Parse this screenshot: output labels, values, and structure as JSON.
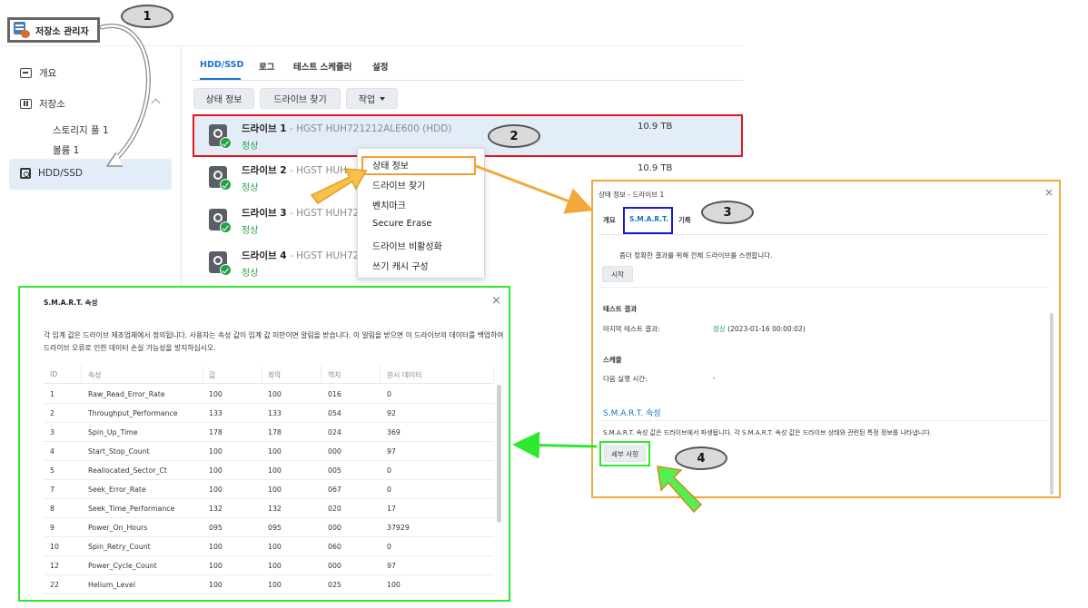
{
  "app": {
    "title": "저장소 관리자"
  },
  "sidebar": {
    "overview": "개요",
    "storage": "저장소",
    "storage_pool": "스토리지 풀 1",
    "volume": "볼륨 1",
    "hdd_ssd": "HDD/SSD"
  },
  "tabs": [
    "HDD/SSD",
    "로그",
    "테스트 스케줄러",
    "설정"
  ],
  "toolbar": {
    "status_info": "상태 정보",
    "find_drive": "드라이브 찾기",
    "action": "작업"
  },
  "drives": [
    {
      "name": "드라이브 1",
      "model": " - HGST HUH721212ALE600 (HDD)",
      "status": "정상",
      "size": "10.9 TB"
    },
    {
      "name": "드라이브 2",
      "model": " - HGST HUH",
      "status": "정상",
      "size": "10.9 TB"
    },
    {
      "name": "드라이브 3",
      "model": " - HGST HUH72",
      "status": "정상",
      "size": ""
    },
    {
      "name": "드라이브 4",
      "model": " - HGST HUH72",
      "status": "정상",
      "size": ""
    }
  ],
  "context_menu": [
    "상태 정보",
    "드라이브 찾기",
    "벤치마크",
    "Secure Erase",
    "드라이브 비활성화",
    "쓰기 캐시 구성"
  ],
  "callouts": [
    "1",
    "2",
    "3",
    "4"
  ],
  "status_dialog": {
    "title": "상태 정보 - 드라이브 1",
    "close": "×",
    "tabs": [
      "개요",
      "S.M.A.R.T.",
      "기록"
    ],
    "scan_text": "좀더 정확한 결과를 위해 전체 드라이브를 스캔합니다.",
    "start_button": "시작",
    "test_result_heading": "테스트 결과",
    "last_test_label": "마지막 테스트 결과:",
    "last_test_status": "정상",
    "last_test_time": " (2023-01-16 00:00:02)",
    "schedule_heading": "스케줄",
    "next_run_label": "다음 실행 시간:",
    "next_run_value": "-",
    "smart_attr_heading": "S.M.A.R.T. 속성",
    "smart_attr_text": "S.M.A.R.T. 속성 값은 드라이브에서 파생됩니다. 각 S.M.A.R.T. 속성 값은 드라이브 상태와 관련된 특정 정보를 나타냅니다.",
    "details_button": "세부 사항"
  },
  "smart_dialog": {
    "title": "S.M.A.R.T. 속성",
    "close": "×",
    "description": "각 임계 값은 드라이브 제조업체에서 정의됩니다. 사용자는 속성 값이 임계 값 미만이면 알림을 받습니다. 이 알림을 받으면 이 드라이브의 데이터를 백업하여 드라이브 오류로 인한 데이터 손실 가능성을 방지하십시오.",
    "columns": [
      "ID",
      "속성",
      "값",
      "최악",
      "역치",
      "원시 데이터"
    ],
    "rows": [
      [
        "1",
        "Raw_Read_Error_Rate",
        "100",
        "100",
        "016",
        "0"
      ],
      [
        "2",
        "Throughput_Performance",
        "133",
        "133",
        "054",
        "92"
      ],
      [
        "3",
        "Spin_Up_Time",
        "178",
        "178",
        "024",
        "369"
      ],
      [
        "4",
        "Start_Stop_Count",
        "100",
        "100",
        "000",
        "97"
      ],
      [
        "5",
        "Reallocated_Sector_Ct",
        "100",
        "100",
        "005",
        "0"
      ],
      [
        "7",
        "Seek_Error_Rate",
        "100",
        "100",
        "067",
        "0"
      ],
      [
        "8",
        "Seek_Time_Performance",
        "132",
        "132",
        "020",
        "17"
      ],
      [
        "9",
        "Power_On_Hours",
        "095",
        "095",
        "000",
        "37929"
      ],
      [
        "10",
        "Spin_Retry_Count",
        "100",
        "100",
        "060",
        "0"
      ],
      [
        "12",
        "Power_Cycle_Count",
        "100",
        "100",
        "000",
        "97"
      ],
      [
        "22",
        "Helium_Level",
        "100",
        "100",
        "025",
        "100"
      ]
    ]
  },
  "colors": {
    "accent": "#1a73c9",
    "ok": "#24a148",
    "red_box": "#e3161e",
    "orange_box": "#f4a73a",
    "green_box": "#2ee82e",
    "blue_box": "#1818d8"
  }
}
